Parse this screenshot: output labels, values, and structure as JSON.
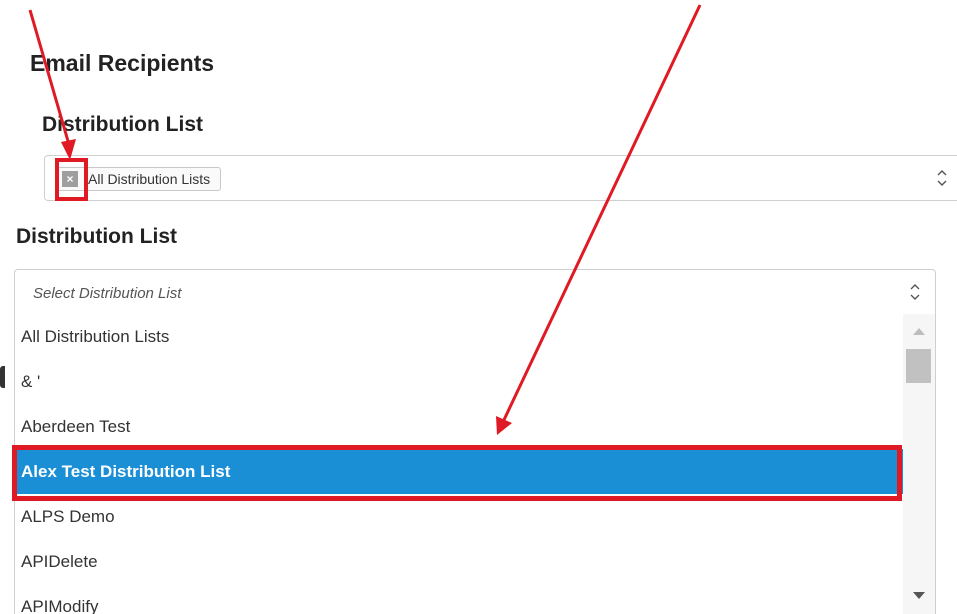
{
  "section": {
    "title": "Email Recipients"
  },
  "distribution_list_1": {
    "label": "Distribution List",
    "chip": {
      "label": "All Distribution Lists",
      "remove_glyph": "×"
    }
  },
  "distribution_list_2": {
    "label": "Distribution List",
    "placeholder": "Select Distribution List",
    "options": [
      "All Distribution Lists",
      "& '",
      "Aberdeen Test",
      "Alex Test Distribution List",
      "ALPS Demo",
      "APIDelete",
      "APIModify"
    ],
    "selected_option": "Alex Test Distribution List"
  },
  "colors": {
    "selected_bg": "#1a8fd6",
    "annotation_red": "#e01a24"
  },
  "icons": {
    "chip_remove": "close-icon",
    "select_arrows": "chevron-up-down-icon",
    "scroll_up": "scroll-up-arrow-icon",
    "scroll_down": "scroll-down-arrow-icon"
  }
}
